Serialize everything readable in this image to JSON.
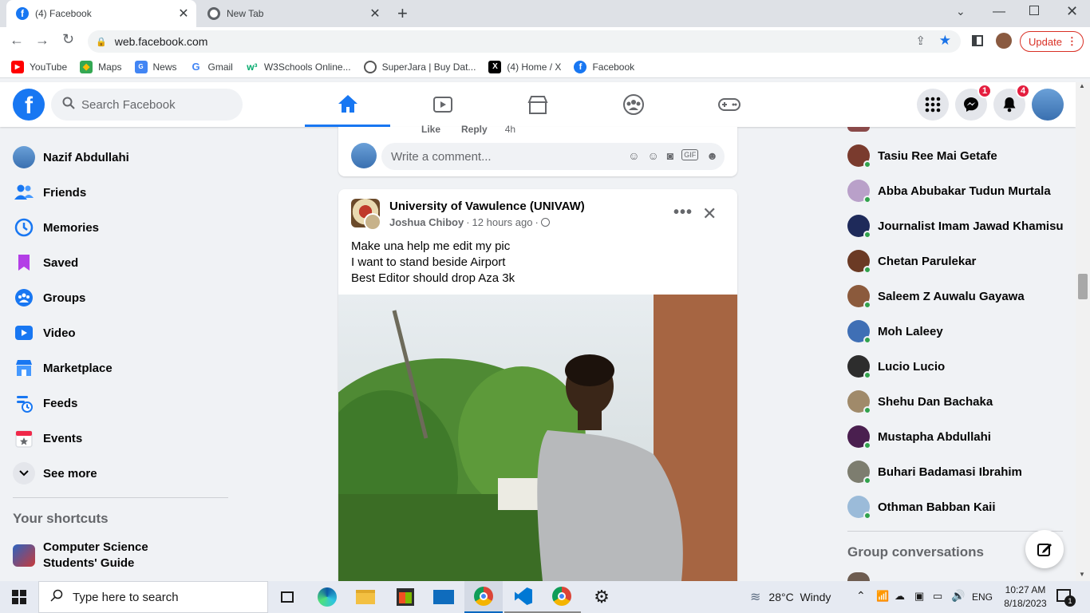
{
  "browser": {
    "tabs": [
      {
        "title": "(4) Facebook"
      },
      {
        "title": "New Tab"
      }
    ],
    "url": "web.facebook.com",
    "update_label": "Update",
    "bookmarks": [
      {
        "label": "YouTube"
      },
      {
        "label": "Maps"
      },
      {
        "label": "News"
      },
      {
        "label": "Gmail"
      },
      {
        "label": "W3Schools Online..."
      },
      {
        "label": "SuperJara | Buy Dat..."
      },
      {
        "label": "(4) Home / X"
      },
      {
        "label": "Facebook"
      }
    ]
  },
  "header": {
    "search_placeholder": "Search Facebook",
    "messenger_badge": "1",
    "notifications_badge": "4"
  },
  "sidebar": {
    "items": [
      {
        "label": "Nazif Abdullahi"
      },
      {
        "label": "Friends"
      },
      {
        "label": "Memories"
      },
      {
        "label": "Saved"
      },
      {
        "label": "Groups"
      },
      {
        "label": "Video"
      },
      {
        "label": "Marketplace"
      },
      {
        "label": "Feeds"
      },
      {
        "label": "Events"
      },
      {
        "label": "See more"
      }
    ],
    "shortcuts_title": "Your shortcuts",
    "shortcuts": [
      {
        "label": "Computer Science Students' Guide"
      }
    ]
  },
  "feed": {
    "prev_actions": {
      "like": "Like",
      "reply": "Reply",
      "time": "4h"
    },
    "comment_placeholder": "Write a comment...",
    "post": {
      "group": "University of Vawulence (UNIVAW)",
      "author": "Joshua Chiboy",
      "time": "12 hours ago",
      "lines": [
        "Make una help me edit my pic",
        "I want to stand beside Airport",
        "Best Editor should drop Aza 3k"
      ]
    }
  },
  "contacts": {
    "items": [
      {
        "name": "Tasiu Ree Mai Getafe",
        "color": "#7a3b2e"
      },
      {
        "name": "Abba Abubakar Tudun Murtala",
        "color": "#b9a0c9"
      },
      {
        "name": "Journalist Imam Jawad Khamisu",
        "color": "#1e2a5a"
      },
      {
        "name": "Chetan Parulekar",
        "color": "#6b3a24"
      },
      {
        "name": "Saleem Z Auwalu Gayawa",
        "color": "#8b5a3c"
      },
      {
        "name": "Moh Laleey",
        "color": "#3f6fb5"
      },
      {
        "name": "Lucio Lucio",
        "color": "#2d2d2d"
      },
      {
        "name": "Shehu Dan Bachaka",
        "color": "#a08a6a"
      },
      {
        "name": "Mustapha Abdullahi",
        "color": "#4a1f4f"
      },
      {
        "name": "Buhari Badamasi Ibrahim",
        "color": "#7d7d6f"
      },
      {
        "name": "Othman Babban Kaii",
        "color": "#9bbbd9"
      }
    ],
    "group_title": "Group conversations"
  },
  "taskbar": {
    "search_placeholder": "Type here to search",
    "weather": "28°C  Windy",
    "lang": "ENG",
    "time": "10:27 AM",
    "date": "8/18/2023",
    "notif_count": "1"
  }
}
